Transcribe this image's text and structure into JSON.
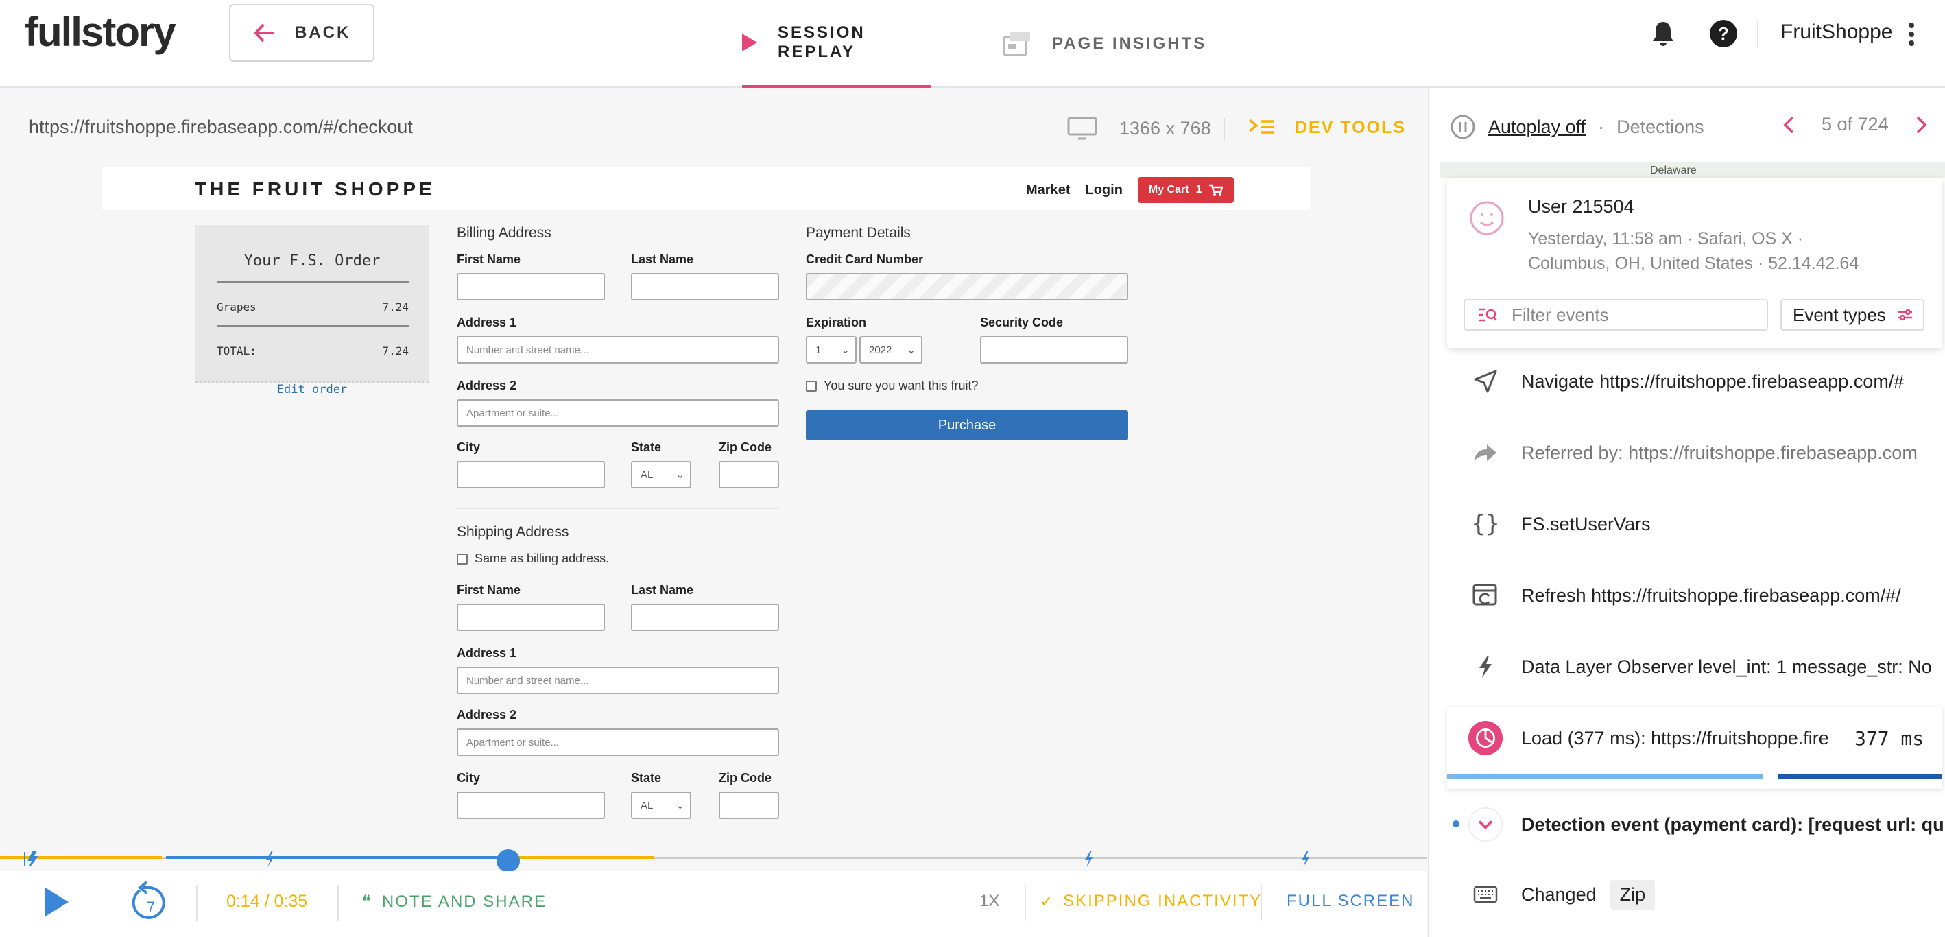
{
  "app": {
    "logo": "fullstory",
    "back_label": "BACK",
    "tabs": [
      {
        "label": "SESSION REPLAY"
      },
      {
        "label": "PAGE INSIGHTS"
      }
    ],
    "org": "FruitShoppe"
  },
  "replay": {
    "url": "https://fruitshoppe.firebaseapp.com/#/checkout",
    "screen_size": "1366 x 768",
    "dev_tools": "DEV TOOLS"
  },
  "site": {
    "title": "THE FRUIT SHOPPE",
    "nav": {
      "market": "Market",
      "login": "Login",
      "cart": "My Cart",
      "cart_count": "1"
    },
    "order": {
      "title": "Your F.S. Order",
      "item": "Grapes",
      "item_price": "7.24",
      "total_label": "TOTAL:",
      "total": "7.24",
      "edit": "Edit order"
    },
    "billing": {
      "title": "Billing Address",
      "first_name": "First Name",
      "last_name": "Last Name",
      "address1": "Address 1",
      "address1_ph": "Number and street name...",
      "address2": "Address 2",
      "address2_ph": "Apartment or suite...",
      "city": "City",
      "state": "State",
      "state_val": "AL",
      "zip": "Zip Code"
    },
    "shipping": {
      "title": "Shipping Address",
      "same": "Same as billing address.",
      "first_name": "First Name",
      "last_name": "Last Name",
      "address1": "Address 1",
      "address1_ph": "Number and street name...",
      "address2": "Address 2",
      "address2_ph": "Apartment or suite...",
      "city": "City",
      "state": "State",
      "state_val": "AL",
      "zip": "Zip Code"
    },
    "payment": {
      "title": "Payment Details",
      "cc": "Credit Card Number",
      "expiration": "Expiration",
      "month": "1",
      "year": "2022",
      "security": "Security Code",
      "confirm": "You sure you want this fruit?",
      "purchase": "Purchase"
    }
  },
  "player": {
    "time": "0:14 / 0:35",
    "note": "NOTE AND SHARE",
    "speed": "1X",
    "skip": "SKIPPING INACTIVITY",
    "fullscreen": "FULL SCREEN",
    "rewind": "7",
    "progress_fraction": 0.4
  },
  "panel": {
    "autoplay": "Autoplay off",
    "separator": "·",
    "detections": "Detections",
    "pager": "5 of 724",
    "map_label": "Delaware",
    "user": {
      "name": "User 215504",
      "meta1": "Yesterday, 11:58 am  ·  Safari, OS X  ·",
      "meta2": "Columbus, OH, United States  ·  52.14.42.64"
    },
    "filter_ph": "Filter events",
    "event_types": "Event types",
    "events": [
      {
        "text": "Navigate https://fruitshoppe.firebaseapp.com/#",
        "icon": "navigate-icon"
      },
      {
        "text": "Referred by: https://fruitshoppe.firebaseapp.com",
        "icon": "share-arrow-icon"
      },
      {
        "text": "FS.setUserVars",
        "icon": "braces-icon"
      },
      {
        "text": "Refresh https://fruitshoppe.firebaseapp.com/#/",
        "icon": "refresh-icon"
      },
      {
        "text": "Data Layer Observer level_int: 1 message_str: No",
        "icon": "bolt-icon"
      },
      {
        "text": "Load (377 ms): https://fruitshoppe.fire",
        "icon": "load-icon",
        "value": "377 ms"
      },
      {
        "text": "Detection event (payment card): [request url: qu",
        "icon": "chevron-down-icon"
      },
      {
        "text": "Changed",
        "icon": "keyboard-icon",
        "chip": "Zip"
      }
    ]
  },
  "colors": {
    "accent_pink": "#e4457a",
    "accent_yellow": "#f5b400",
    "accent_blue": "#3a86d8",
    "accent_green": "#4aa36b"
  }
}
